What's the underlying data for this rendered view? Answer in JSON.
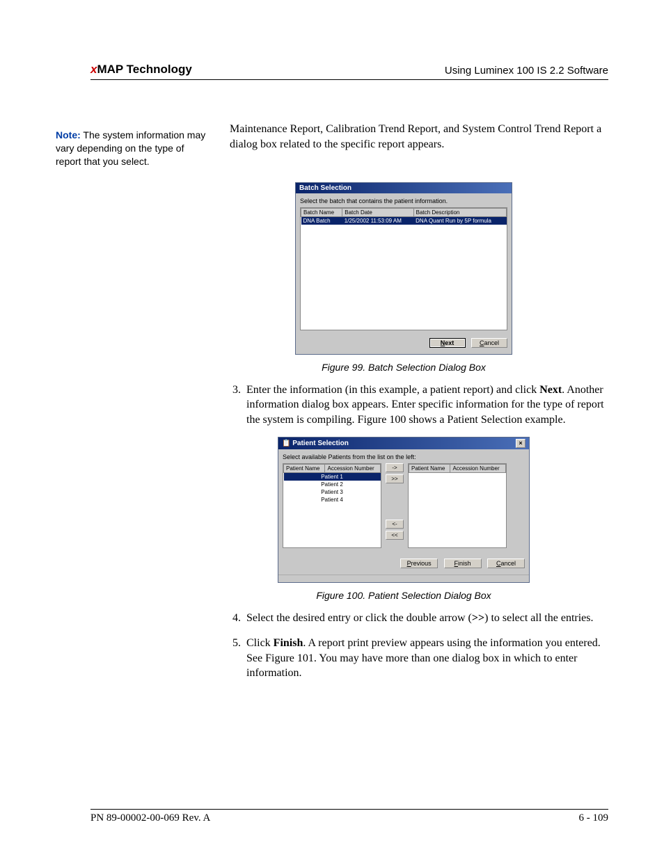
{
  "header": {
    "brand_x": "x",
    "brand_rest": "MAP Technology",
    "right": "Using Luminex 100 IS 2.2 Software"
  },
  "note": {
    "label": "Note:",
    "text": " The system information may vary depending on the type of report that you select."
  },
  "intro": "Maintenance Report, Calibration Trend Report, and System Control Trend Report a dialog box related to the specific report appears.",
  "fig99": {
    "title": "Batch Selection",
    "instr": "Select the batch that contains the patient information.",
    "cols": [
      "Batch Name",
      "Batch Date",
      "Batch Description"
    ],
    "row": [
      "DNA Batch",
      "1/25/2002 11:53:09 AM",
      "DNA Quant Run by 5P formula"
    ],
    "next_N": "N",
    "next_rest": "ext",
    "cancel_C": "C",
    "cancel_rest": "ancel",
    "caption": "Figure 99.  Batch Selection Dialog Box"
  },
  "steps": {
    "s3a": "Enter the information (in this example, a patient report) and click ",
    "s3b": "Next",
    "s3c": ". Another information dialog box appears. Enter specific information for the type of report the system is compiling. Figure 100 shows a Patient Selection example.",
    "s4a": "Select the desired entry or click the double arrow (",
    "s4b": ">>",
    "s4c": ") to select all the entries.",
    "s5a": "Click ",
    "s5b": "Finish",
    "s5c": ". A report print preview appears using the information you entered. See Figure 101. You may have more than one dialog box in which to enter information."
  },
  "fig100": {
    "title": "Patient Selection",
    "close": "×",
    "instr": "Select available Patients from the list on the left:",
    "left_cols": [
      "Patient Name",
      "Accession Number"
    ],
    "right_cols": [
      "Patient Name",
      "Accession Number"
    ],
    "rows": [
      "Patient 1",
      "Patient 2",
      "Patient 3",
      "Patient 4"
    ],
    "mv_add": "->",
    "mv_addall": ">>",
    "mv_rem": "<-",
    "mv_remall": "<<",
    "prev_P": "P",
    "prev_rest": "revious",
    "fin_F": "F",
    "fin_rest": "inish",
    "can_C": "C",
    "can_rest": "ancel",
    "caption": "Figure 100.  Patient Selection Dialog Box"
  },
  "footer": {
    "left": "PN 89-00002-00-069 Rev. A",
    "right": "6 - 109"
  }
}
